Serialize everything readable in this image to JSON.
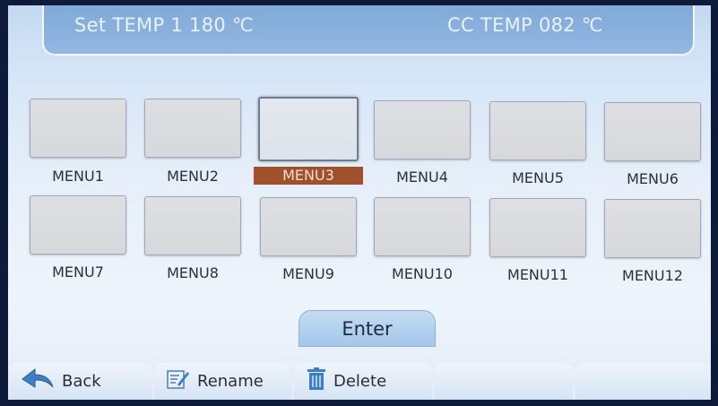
{
  "header": {
    "set_temp": "Set TEMP 1 180 ℃",
    "cc_temp": "CC TEMP 082 ℃"
  },
  "menu": {
    "selected": "MENU3",
    "items": [
      {
        "label": "MENU1"
      },
      {
        "label": "MENU2"
      },
      {
        "label": "MENU3"
      },
      {
        "label": "MENU4"
      },
      {
        "label": "MENU5"
      },
      {
        "label": "MENU6"
      },
      {
        "label": "MENU7"
      },
      {
        "label": "MENU8"
      },
      {
        "label": "MENU9"
      },
      {
        "label": "MENU10"
      },
      {
        "label": "MENU11"
      },
      {
        "label": "MENU12"
      }
    ]
  },
  "enter_label": "Enter",
  "toolbar": {
    "back_label": "Back",
    "rename_label": "Rename",
    "delete_label": "Delete"
  },
  "icons": {
    "back": "back-arrow-icon",
    "rename": "edit-icon",
    "delete": "trash-icon"
  },
  "colors": {
    "selected_label_bg": "#a0512c",
    "header_bg": "#7da6d6"
  }
}
